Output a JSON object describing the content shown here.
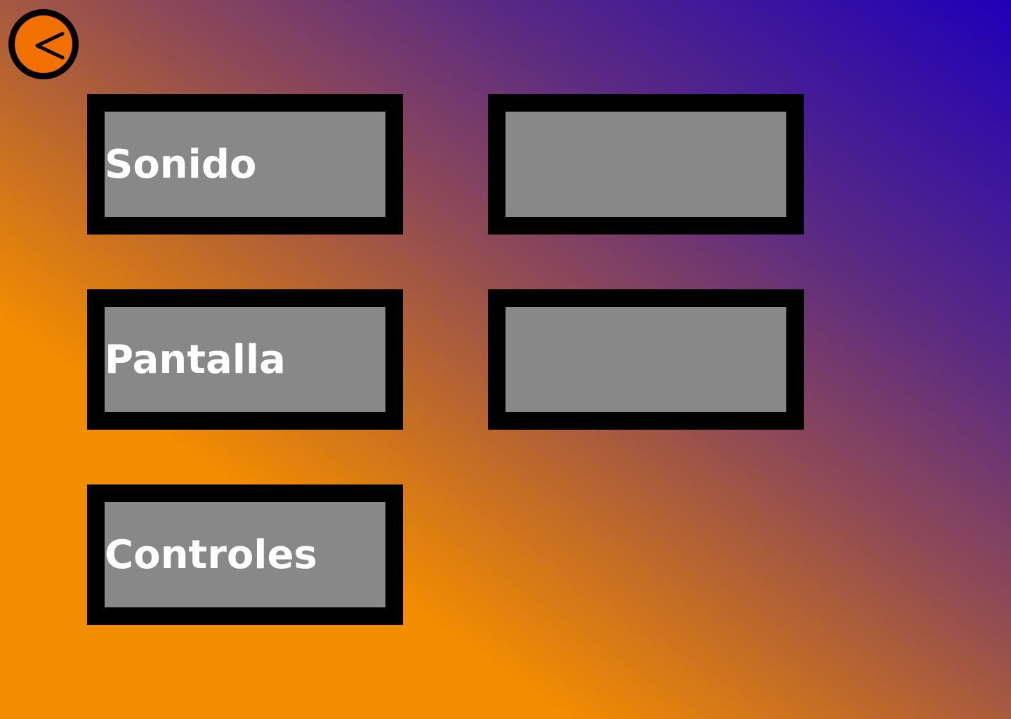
{
  "back_button": {
    "icon": "chevron-left-icon",
    "fill_color": "#f07000",
    "border_color": "#000000"
  },
  "menu": {
    "tiles": [
      {
        "label": "Sonido"
      },
      {
        "label": "Pantalla"
      },
      {
        "label": "Controles"
      },
      {
        "label": ""
      },
      {
        "label": ""
      }
    ]
  },
  "colors": {
    "background_start": "#f28c00",
    "background_end": "#1e00b8",
    "tile_border": "#000000",
    "tile_face": "#8c8c8c",
    "label_text": "#ffffff"
  }
}
